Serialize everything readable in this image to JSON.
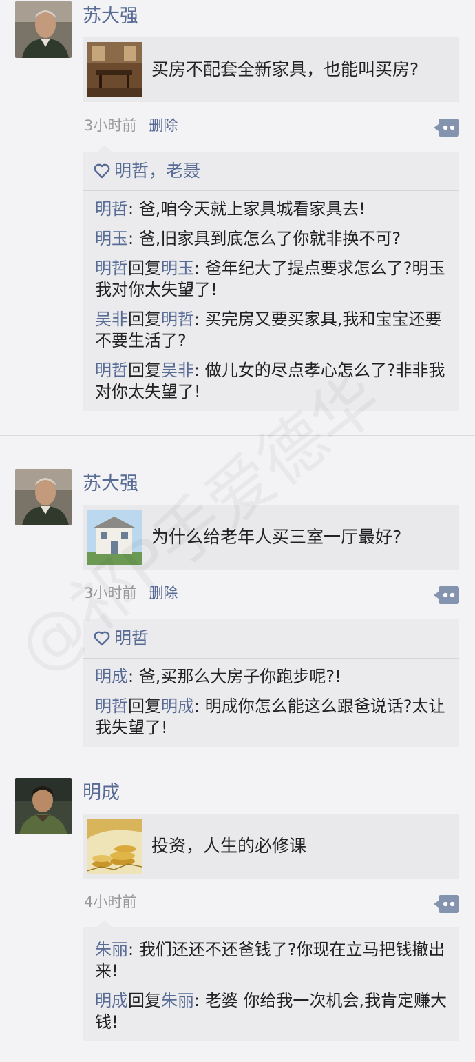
{
  "watermark": "@祁P手爱德华",
  "posts": [
    {
      "author": "苏大强",
      "share_title": "买房不配套全新家具，也能叫买房?",
      "time": "3小时前",
      "delete": "删除",
      "likes": "明哲，老聂",
      "comments": [
        {
          "from": "明哲",
          "reply": "",
          "to": "",
          "text": ": 爸,咱今天就上家具城看家具去!"
        },
        {
          "from": "明玉",
          "reply": "",
          "to": "",
          "text": ": 爸,旧家具到底怎么了你就非换不可?"
        },
        {
          "from": "明哲",
          "reply": "回复",
          "to": "明玉",
          "text": ": 爸年纪大了提点要求怎么了?明玉我对你太失望了!"
        },
        {
          "from": "吴非",
          "reply": "回复",
          "to": "明哲",
          "text": ": 买完房又要买家具,我和宝宝还要不要生活了?"
        },
        {
          "from": "明哲",
          "reply": "回复",
          "to": "吴非",
          "text": ": 做儿女的尽点孝心怎么了?非非我对你太失望了!"
        }
      ]
    },
    {
      "author": "苏大强",
      "share_title": "为什么给老年人买三室一厅最好?",
      "time": "3小时前",
      "delete": "删除",
      "likes": "明哲",
      "comments": [
        {
          "from": "明成",
          "reply": "",
          "to": "",
          "text": ": 爸,买那么大房子你跑步呢?!"
        },
        {
          "from": "明哲",
          "reply": "回复",
          "to": "明成",
          "text": ": 明成你怎么能这么跟爸说话?太让我失望了!"
        }
      ]
    },
    {
      "author": "明成",
      "share_title": "投资，人生的必修课",
      "time": "4小时前",
      "delete": "",
      "likes": "",
      "comments": [
        {
          "from": "朱丽",
          "reply": "",
          "to": "",
          "text": ": 我们还还不还爸钱了?你现在立马把钱撤出来!"
        },
        {
          "from": "明成",
          "reply": "回复",
          "to": "朱丽",
          "text": ": 老婆 你给我一次机会,我肯定赚大钱!"
        }
      ]
    }
  ]
}
